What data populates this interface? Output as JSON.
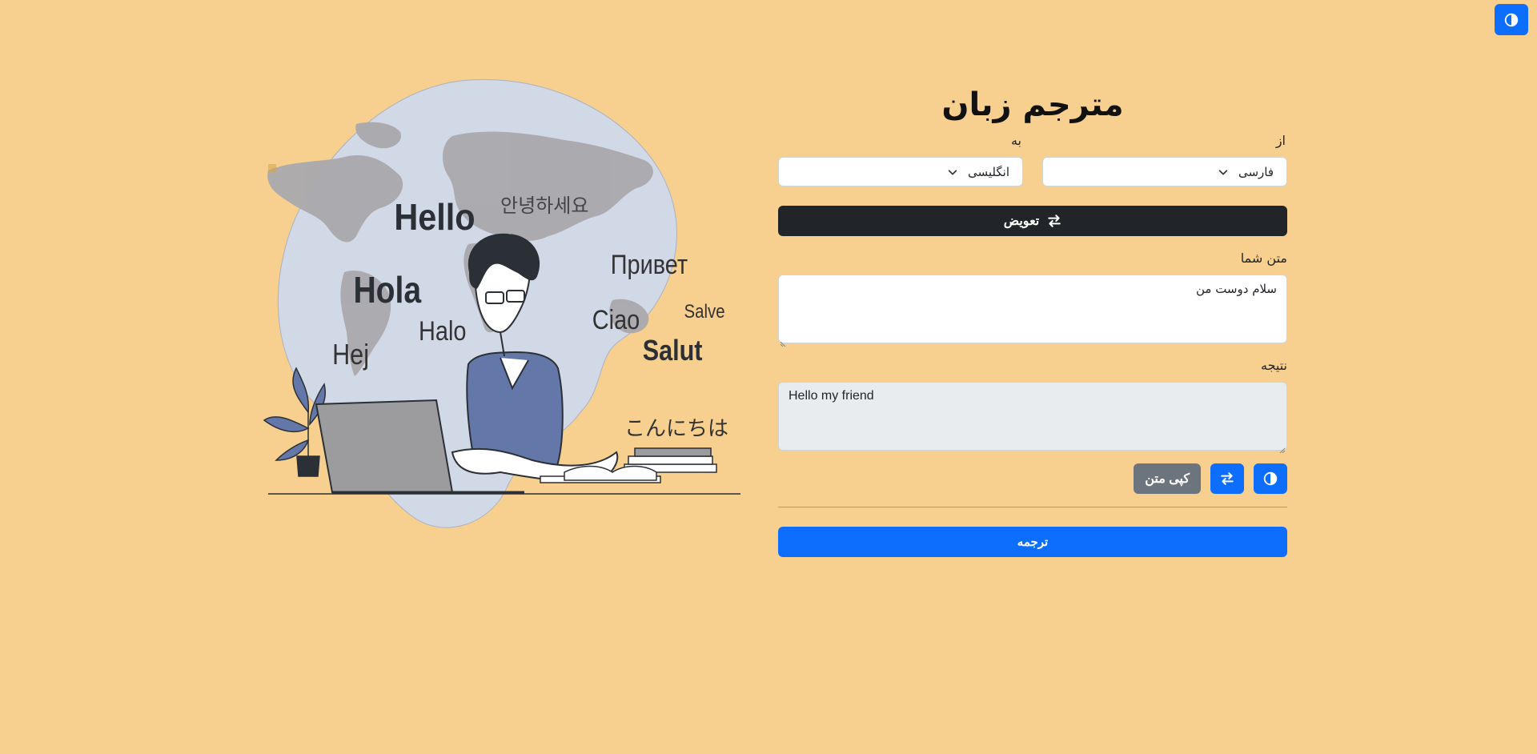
{
  "header": {
    "title": "مترجم زبان",
    "theme_toggle_icon": "contrast-icon"
  },
  "languages": {
    "from_label": "از",
    "to_label": "به",
    "from_value": "فارسی",
    "to_value": "انگلیسی"
  },
  "swap": {
    "label": "تعویض",
    "icon": "swap-arrows-icon"
  },
  "input": {
    "label": "متن شما",
    "value": "سلام دوست من"
  },
  "result": {
    "label": "نتیجه",
    "value": "Hello my friend"
  },
  "actions": {
    "copy_label": "کپی متن",
    "swap_icon": "swap-arrows-icon",
    "theme_icon": "contrast-icon"
  },
  "translate": {
    "label": "ترجمه"
  },
  "illustration": {
    "greetings": [
      "Hello",
      "안녕하세요",
      "Привет",
      "Hola",
      "Halo",
      "Salve",
      "Ciao",
      "Hej",
      "Salut",
      "こんにちは"
    ]
  },
  "colors": {
    "background": "#f7cf8f",
    "primary": "#0d6efd",
    "dark": "#212529",
    "secondary": "#6c757d",
    "blob": "#d1d8e6"
  }
}
